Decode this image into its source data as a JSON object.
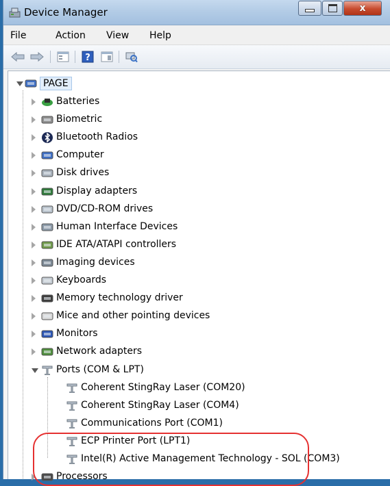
{
  "window": {
    "title": "Device Manager",
    "close_glyph": "x"
  },
  "menu": [
    "File",
    "Action",
    "View",
    "Help"
  ],
  "toolbar": [
    "back-arrow-icon",
    "forward-arrow-icon",
    "properties-icon",
    "help-icon",
    "view-icon",
    "scan-hardware-icon"
  ],
  "tree": {
    "root": "PAGE",
    "categories": [
      {
        "label": "Batteries",
        "icon": "battery-icon"
      },
      {
        "label": "Biometric",
        "icon": "biometric-icon"
      },
      {
        "label": "Bluetooth Radios",
        "icon": "bluetooth-icon"
      },
      {
        "label": "Computer",
        "icon": "computer-icon"
      },
      {
        "label": "Disk drives",
        "icon": "disk-drive-icon"
      },
      {
        "label": "Display adapters",
        "icon": "display-adapter-icon"
      },
      {
        "label": "DVD/CD-ROM drives",
        "icon": "dvd-drive-icon"
      },
      {
        "label": "Human Interface Devices",
        "icon": "hid-icon"
      },
      {
        "label": "IDE ATA/ATAPI controllers",
        "icon": "ide-controller-icon"
      },
      {
        "label": "Imaging devices",
        "icon": "camera-icon"
      },
      {
        "label": "Keyboards",
        "icon": "keyboard-icon"
      },
      {
        "label": "Memory technology driver",
        "icon": "memory-icon"
      },
      {
        "label": "Mice and other pointing devices",
        "icon": "mouse-icon"
      },
      {
        "label": "Monitors",
        "icon": "monitor-icon"
      },
      {
        "label": "Network adapters",
        "icon": "network-icon"
      }
    ],
    "ports": {
      "label": "Ports (COM & LPT)",
      "children": [
        "Coherent StingRay Laser (COM20)",
        "Coherent StingRay Laser (COM4)",
        "Communications Port (COM1)",
        "ECP Printer Port (LPT1)",
        "Intel(R) Active Management Technology - SOL (COM3)"
      ]
    },
    "after": [
      {
        "label": "Processors",
        "icon": "processor-icon"
      }
    ]
  },
  "colors": {
    "highlight": "#e53030",
    "selection": "#e2eefb"
  }
}
